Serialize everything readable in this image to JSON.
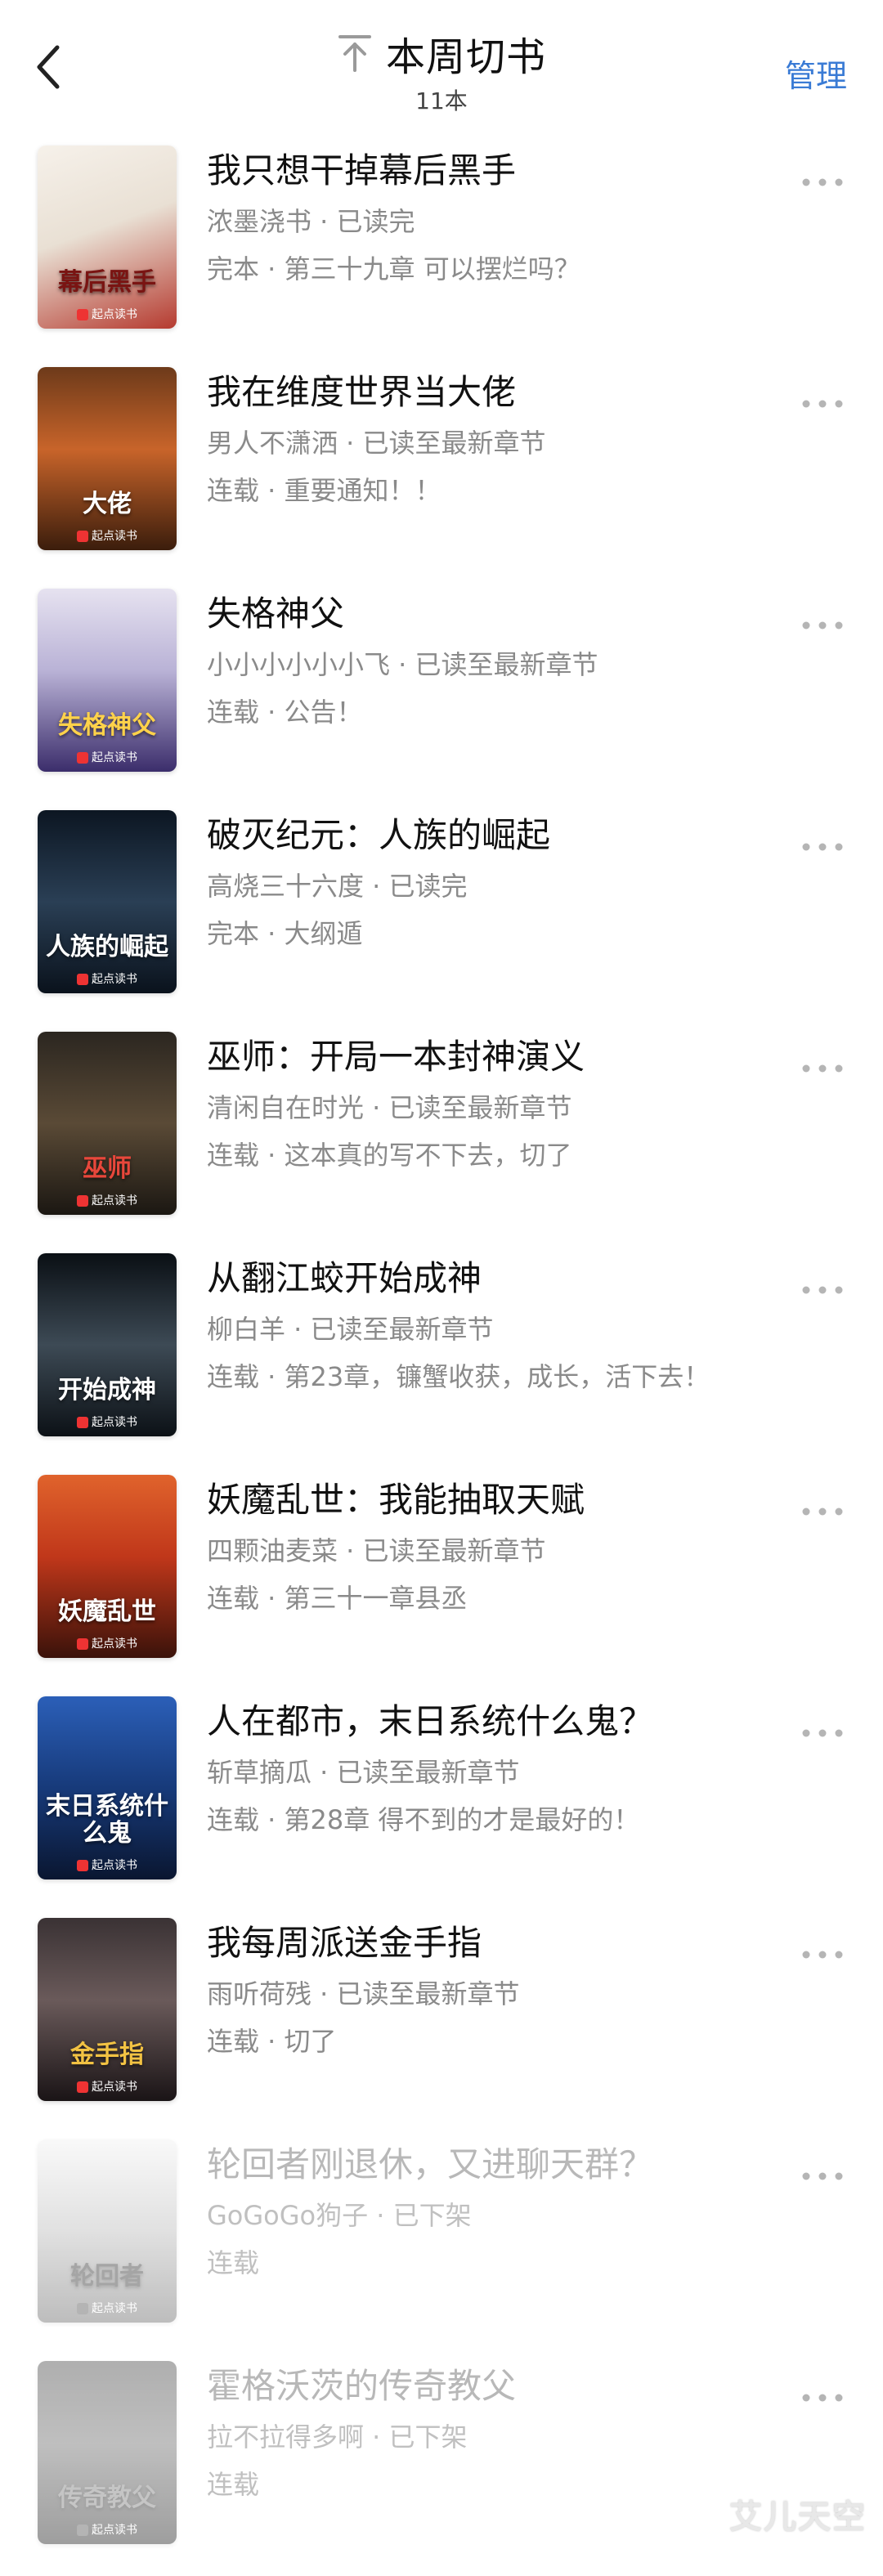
{
  "header": {
    "back_icon": "chevron-left-icon",
    "pin_icon": "pin-top-icon",
    "title": "本周切书",
    "count": "11本",
    "manage_label": "管理",
    "accent_color": "#3a7bd5"
  },
  "cover_brand": "起点读书",
  "books": [
    {
      "title": "我只想干掉幕后黑手",
      "author": "浓墨浇书",
      "read_state": "已读完",
      "status": "完本",
      "latest": "第三十九章 可以摆烂吗？",
      "cover_text": "幕后黑手",
      "cover_bg": "linear-gradient(160deg,#f6f1ea 0%,#e9e0d4 45%,#b53a2f 100%)",
      "cover_text_color": "#7a1412"
    },
    {
      "title": "我在维度世界当大佬",
      "author": "男人不潇洒",
      "read_state": "已读至最新章节",
      "status": "连载",
      "latest": "重要通知！！",
      "cover_text": "大佬",
      "cover_bg": "linear-gradient(180deg,#6d3a1a 0%,#c8642a 45%,#3b1d0c 100%)",
      "cover_text_color": "#ffffff"
    },
    {
      "title": "失格神父",
      "author": "小小小小小小飞",
      "read_state": "已读至最新章节",
      "status": "连载",
      "latest": "公告！",
      "cover_text": "失格神父",
      "cover_bg": "linear-gradient(180deg,#e6e2f0 0%,#b9b2d6 45%,#3b2d6b 100%)",
      "cover_text_color": "#ffd24a"
    },
    {
      "title": "破灭纪元：人族的崛起",
      "author": "高烧三十六度",
      "read_state": "已读完",
      "status": "完本",
      "latest": "大纲遁",
      "cover_text": "人族的崛起",
      "cover_bg": "linear-gradient(180deg,#0c1622 0%,#2a3f55 50%,#0a121c 100%)",
      "cover_text_color": "#ffffff"
    },
    {
      "title": "巫师：开局一本封神演义",
      "author": "清闲自在时光",
      "read_state": "已读至最新章节",
      "status": "连载",
      "latest": "这本真的写不下去，切了",
      "cover_text": "巫师",
      "cover_bg": "linear-gradient(180deg,#2b2620 0%,#5a4a36 50%,#1b1712 100%)",
      "cover_text_color": "#e8473b"
    },
    {
      "title": "从翻江蛟开始成神",
      "author": "柳白羊",
      "read_state": "已读至最新章节",
      "status": "连载",
      "latest": "第23章，镰蟹收获，成长，活下去！",
      "cover_text": "开始成神",
      "cover_bg": "linear-gradient(180deg,#0a0f14 0%,#3d4a55 50%,#0c1116 100%)",
      "cover_text_color": "#ffffff"
    },
    {
      "title": "妖魔乱世：我能抽取天赋",
      "author": "四颗油麦菜",
      "read_state": "已读至最新章节",
      "status": "连载",
      "latest": "第三十一章县丞",
      "cover_text": "妖魔乱世",
      "cover_bg": "linear-gradient(180deg,#e0632c 0%,#c0371a 45%,#3a120a 100%)",
      "cover_text_color": "#ffffff"
    },
    {
      "title": "人在都市，末日系统什么鬼？",
      "author": "斩草摘瓜",
      "read_state": "已读至最新章节",
      "status": "连载",
      "latest": "第28章 得不到的才是最好的！",
      "cover_text": "末日系统什么鬼",
      "cover_bg": "linear-gradient(180deg,#2b5fb8 0%,#173a7a 50%,#0a1630 100%)",
      "cover_text_color": "#ffffff"
    },
    {
      "title": "我每周派送金手指",
      "author": "雨听荷残",
      "read_state": "已读至最新章节",
      "status": "连载",
      "latest": "切了",
      "cover_text": "金手指",
      "cover_bg": "linear-gradient(180deg,#3a3234 0%,#6a5a5a 45%,#1a1416 100%)",
      "cover_text_color": "#f2c243"
    },
    {
      "title": "轮回者刚退休，又进聊天群？",
      "author": "GoGoGo狗子",
      "read_state": "已下架",
      "status": "连载",
      "latest": "",
      "cover_text": "轮回者",
      "cover_bg": "linear-gradient(180deg,#f2f2f2 0%,#bdbdbd 50%,#6e6e6e 100%)",
      "cover_text_color": "#3a3a3a",
      "removed": true
    },
    {
      "title": "霍格沃茨的传奇教父",
      "author": "拉不拉得多啊",
      "read_state": "已下架",
      "status": "连载",
      "latest": "",
      "cover_text": "传奇教父",
      "cover_bg": "linear-gradient(180deg,#6a4a3a 0%,#9a6a52 45%,#3a261c 100%)",
      "cover_text_color": "#d86a48",
      "removed": true
    }
  ],
  "watermark": "艾儿天空"
}
